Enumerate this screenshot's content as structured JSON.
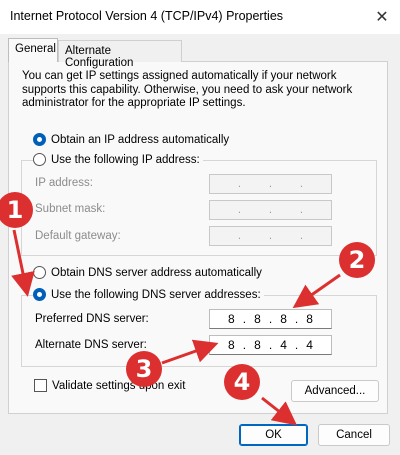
{
  "window": {
    "title": "Internet Protocol Version 4 (TCP/IPv4) Properties",
    "close_glyph": "✕"
  },
  "tabs": [
    {
      "label": "General",
      "selected": true
    },
    {
      "label": "Alternate Configuration",
      "selected": false
    }
  ],
  "intro_text": "You can get IP settings assigned automatically if your network supports this capability. Otherwise, you need to ask your network administrator for the appropriate IP settings.",
  "ip_section": {
    "auto_label": "Obtain an IP address automatically",
    "auto_selected": true,
    "manual_label": "Use the following IP address:",
    "manual_selected": false,
    "fields": [
      {
        "label": "IP address:",
        "value": [
          "",
          "",
          "",
          ""
        ]
      },
      {
        "label": "Subnet mask:",
        "value": [
          "",
          "",
          "",
          ""
        ]
      },
      {
        "label": "Default gateway:",
        "value": [
          "",
          "",
          "",
          ""
        ]
      }
    ]
  },
  "dns_section": {
    "auto_label": "Obtain DNS server address automatically",
    "auto_selected": false,
    "manual_label": "Use the following DNS server addresses:",
    "manual_selected": true,
    "preferred": {
      "label": "Preferred DNS server:",
      "octets": [
        "8",
        "8",
        "8",
        "8"
      ]
    },
    "alternate": {
      "label": "Alternate DNS server:",
      "octets": [
        "8",
        "8",
        "4",
        "4"
      ]
    }
  },
  "validate": {
    "label": "Validate settings upon exit",
    "checked": false
  },
  "buttons": {
    "advanced": "Advanced...",
    "ok": "OK",
    "cancel": "Cancel"
  },
  "annotations": {
    "badge1": "1",
    "badge2": "2",
    "badge3": "3",
    "badge4": "4",
    "color": "#dc2f2f"
  }
}
